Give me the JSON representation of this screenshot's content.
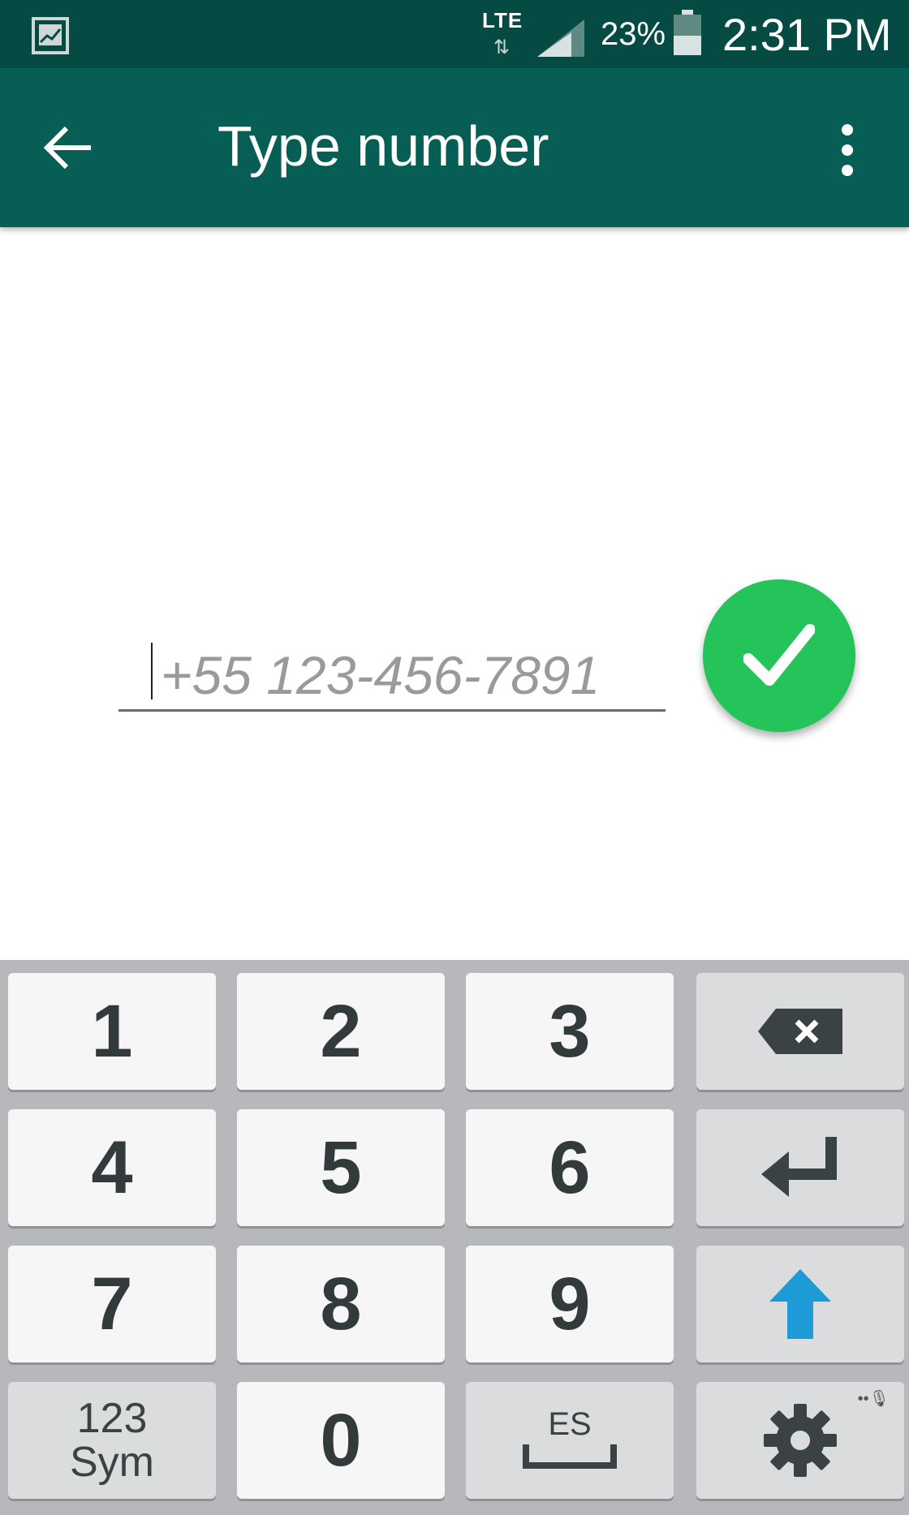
{
  "status_bar": {
    "network": "LTE",
    "battery_percent": "23%",
    "time": "2:31 PM",
    "icons": [
      "gallery-notification-icon",
      "data-transfer-icon",
      "signal-icon",
      "battery-icon"
    ]
  },
  "app_bar": {
    "title": "Type number",
    "back_icon": "arrow-left-icon",
    "menu_icon": "more-vert-icon",
    "colors": {
      "app_bar": "#075e54",
      "status_bar": "#064b43"
    }
  },
  "input": {
    "placeholder": "+55 123-456-7891",
    "value": ""
  },
  "confirm_button": {
    "icon": "checkmark-icon",
    "color": "#25c45b"
  },
  "keyboard": {
    "keys": {
      "k1": "1",
      "k2": "2",
      "k3": "3",
      "k4": "4",
      "k5": "5",
      "k6": "6",
      "k7": "7",
      "k8": "8",
      "k9": "9",
      "k0": "0"
    },
    "sym_line1": "123",
    "sym_line2": "Sym",
    "language": "ES",
    "function_icons": [
      "backspace-icon",
      "enter-icon",
      "shift-icon",
      "space-icon",
      "settings-icon"
    ],
    "shift_color": "#1e9bd7"
  }
}
